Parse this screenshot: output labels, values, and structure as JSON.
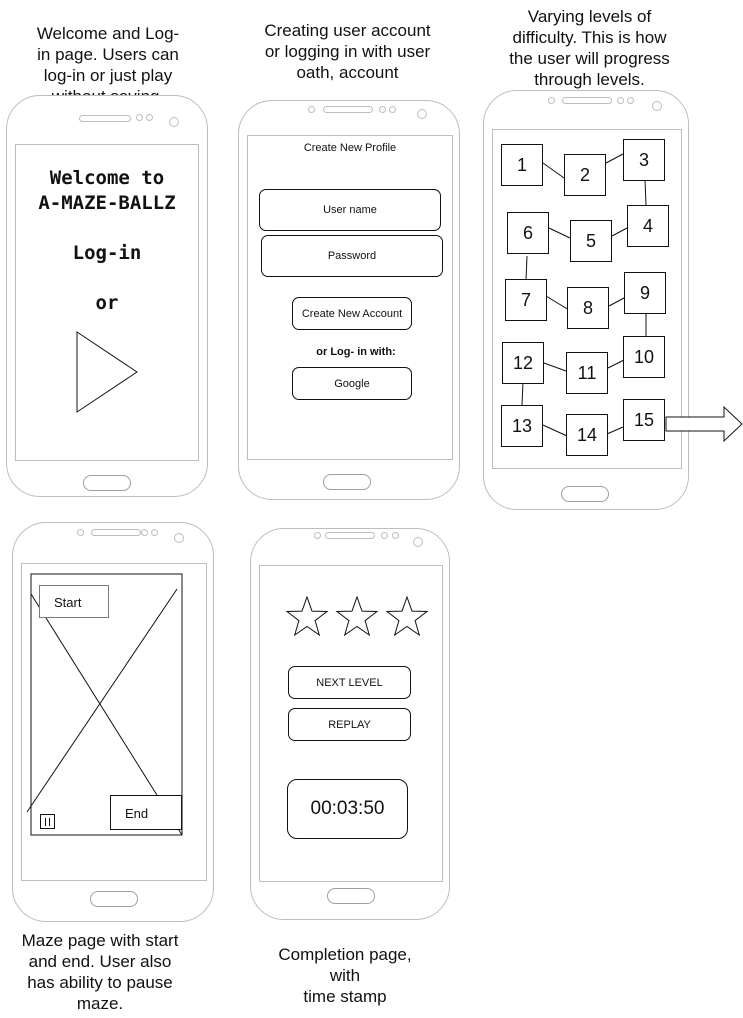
{
  "captions": {
    "welcome": "Welcome and Log-\nin page. Users can\nlog-in or just play\nwithout saving.",
    "create": "Creating user account\nor logging in with user\noath, account",
    "levels": "Varying levels of\ndifficulty. This is how\nthe user will progress\nthrough levels.",
    "maze": "Maze page with start\nand end. User also\nhas ability to pause\nmaze.",
    "completion": "Completion page,\nwith\ntime stamp"
  },
  "welcome_screen": {
    "title_line1": "Welcome to",
    "title_line2": "A-MAZE-BALLZ",
    "login": "Log-in",
    "or": "or",
    "play_icon": "play-triangle-icon"
  },
  "create_screen": {
    "heading": "Create New Profile",
    "username_placeholder": "User name",
    "password_placeholder": "Password",
    "create_button": "Create New Account",
    "or_login": "or Log- in with:",
    "google_button": "Google"
  },
  "levels_screen": {
    "levels": [
      "1",
      "2",
      "3",
      "4",
      "5",
      "6",
      "7",
      "8",
      "9",
      "10",
      "11",
      "12",
      "13",
      "14",
      "15"
    ],
    "next_arrow_icon": "right-arrow-icon"
  },
  "maze_screen": {
    "start": "Start",
    "end": "End",
    "pause_icon": "pause-icon"
  },
  "completion_screen": {
    "stars": 3,
    "star_icon": "star-outline-icon",
    "next_level": "NEXT LEVEL",
    "replay": "REPLAY",
    "time": "00:03:50"
  }
}
